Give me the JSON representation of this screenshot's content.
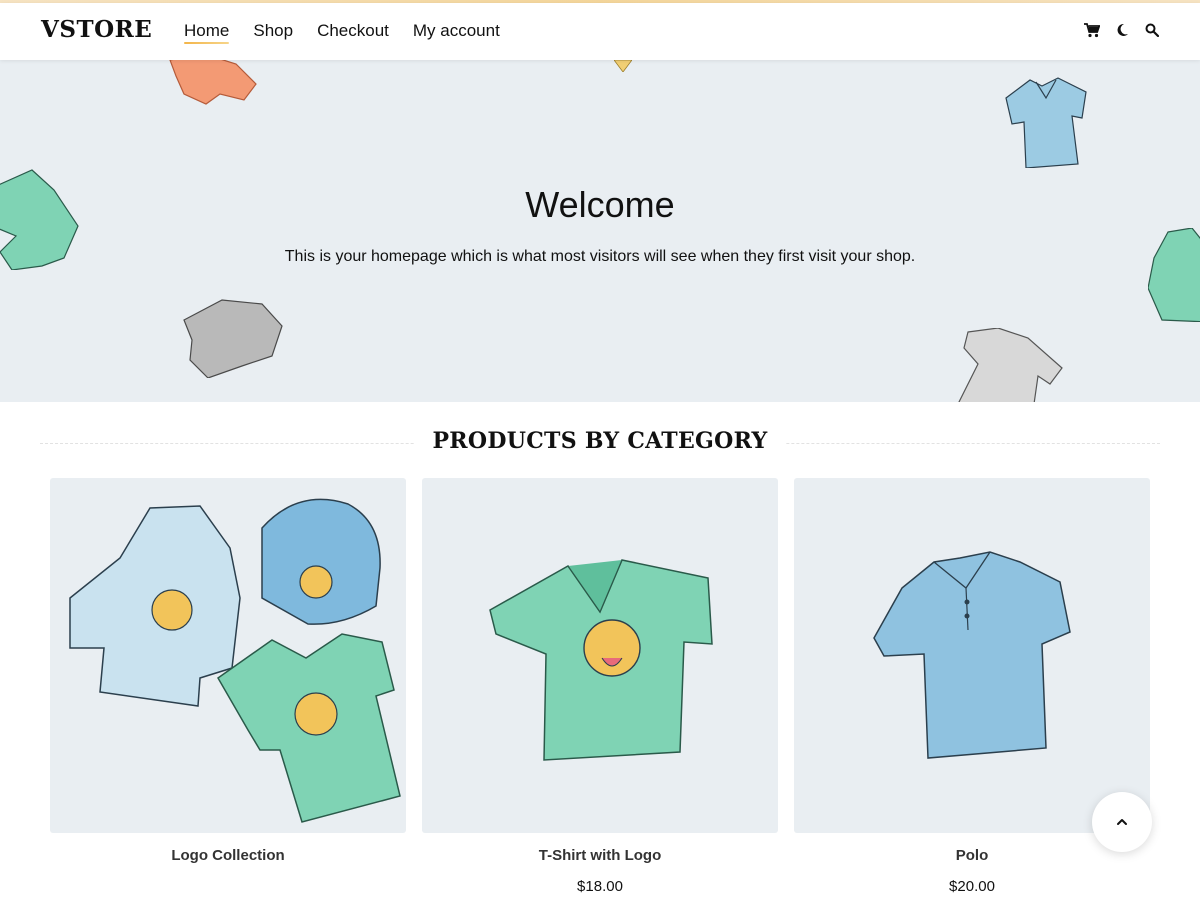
{
  "brand": {
    "name": "VSTORE",
    "accent": "#f3b54a"
  },
  "nav": {
    "items": [
      {
        "label": "Home",
        "active": true
      },
      {
        "label": "Shop",
        "active": false
      },
      {
        "label": "Checkout",
        "active": false
      },
      {
        "label": "My account",
        "active": false
      }
    ]
  },
  "toolbar": {
    "icons": [
      "cart-icon",
      "moon-icon",
      "search-icon"
    ]
  },
  "hero": {
    "title": "Welcome",
    "text": "This is your homepage which is what most visitors will see when they first visit your shop.",
    "background": "#e9eef2"
  },
  "section": {
    "title": "PRODUCTS BY CATEGORY"
  },
  "products": [
    {
      "name": "Logo Collection",
      "price": ""
    },
    {
      "name": "T-Shirt with Logo",
      "price": "$18.00"
    },
    {
      "name": "Polo",
      "price": "$20.00"
    }
  ],
  "colors": {
    "mint": "#7fd3b4",
    "sky": "#9ccbe3",
    "orange": "#f39a74",
    "grey": "#b9b9b9"
  }
}
